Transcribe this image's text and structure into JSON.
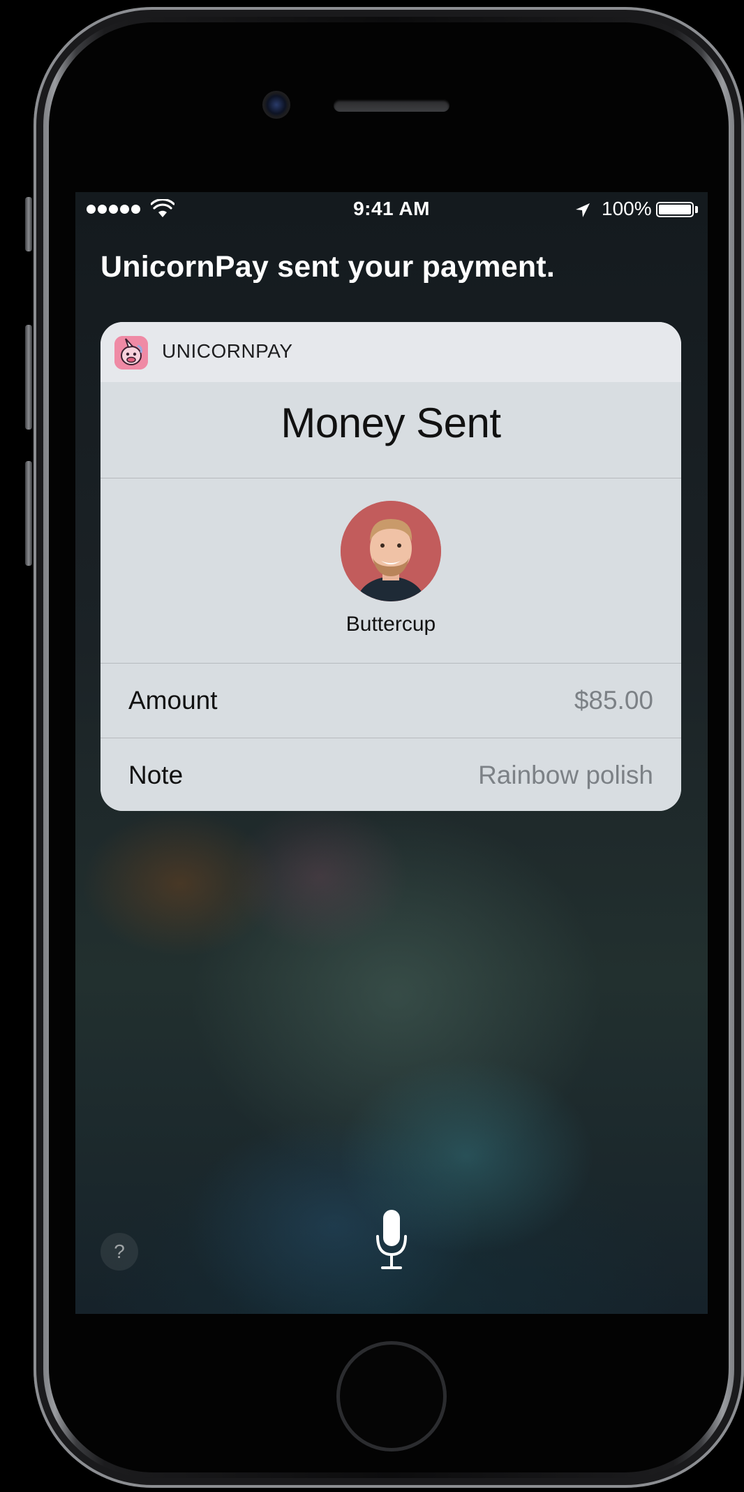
{
  "status_bar": {
    "time": "9:41 AM",
    "battery_percent": "100%",
    "signal_dots": 5,
    "battery_level": 1.0
  },
  "siri": {
    "response_text": "UnicornPay sent your payment."
  },
  "card": {
    "app_name": "UNICORNPAY",
    "title": "Money Sent",
    "recipient_name": "Buttercup",
    "rows": [
      {
        "label": "Amount",
        "value": "$85.00"
      },
      {
        "label": "Note",
        "value": "Rainbow polish"
      }
    ]
  },
  "bottom": {
    "help_label": "?"
  },
  "icons": {
    "signal": "cellular-signal-icon",
    "wifi": "wifi-icon",
    "location": "location-arrow-icon",
    "battery": "battery-icon",
    "app": "unicorn-app-icon",
    "mic": "microphone-icon",
    "help": "question-mark-icon"
  },
  "colors": {
    "card_header": "#e6e8ec",
    "card_body": "#d8dde1",
    "value_text": "#7c8186",
    "app_icon_bg": "#ef8aa5"
  }
}
